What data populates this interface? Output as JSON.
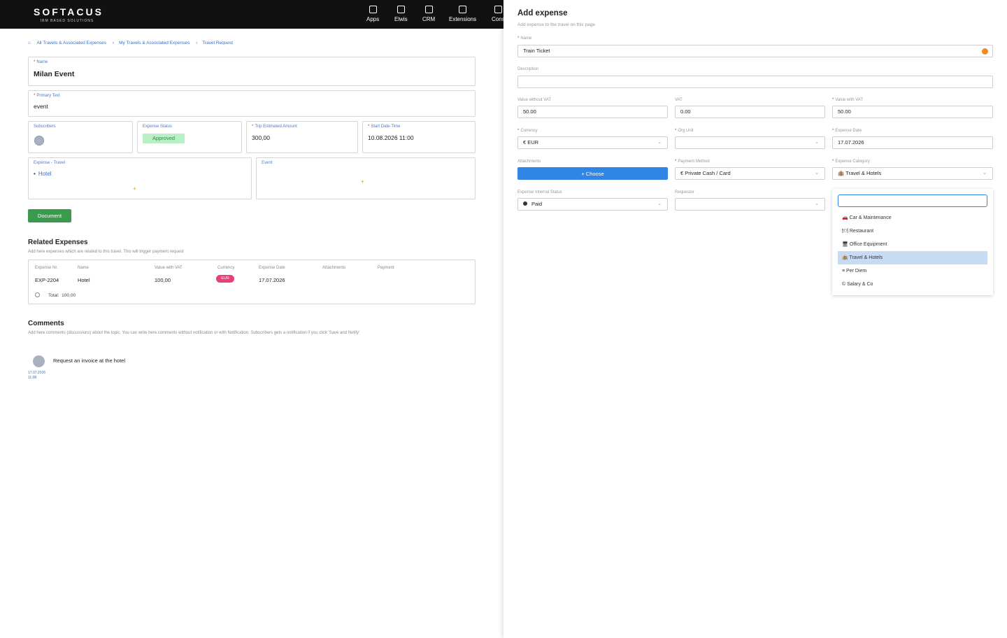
{
  "topbar": {
    "brand": "SOFTACUS",
    "tagline": "IBM BASED SOLUTIONS",
    "nav": [
      {
        "label": "Apps",
        "icon": "apps-icon"
      },
      {
        "label": "Elwis",
        "icon": "elwis-icon"
      },
      {
        "label": "CRM",
        "icon": "crm-icon"
      },
      {
        "label": "Extensions",
        "icon": "extensions-icon"
      },
      {
        "label": "Cons",
        "icon": "console-icon"
      }
    ]
  },
  "breadcrumb": {
    "home_icon": "home-icon",
    "items": [
      "All Travels & Associated Expenses",
      "My Travels & Associated Expenses",
      "Travel Request"
    ]
  },
  "travel": {
    "name_label": "Name",
    "name_value": "Milan Event",
    "primary_text_label": "Primary Text",
    "primary_text_value": "event",
    "subscribers_label": "Subscribers",
    "expense_status_label": "Expense Status",
    "expense_status_value": "Approved",
    "trip_amount_label": "Trip Estimated Amount",
    "trip_amount_value": "300,00",
    "start_label": "Start Date-Time",
    "start_value": "10.08.2026 11:00",
    "expense_travel_label": "Expense - Travel",
    "expense_travel_item": "Hotel",
    "event_label": "Event",
    "add_symbol": "+",
    "document_button": "Document"
  },
  "related": {
    "title": "Related Expenses",
    "subtitle": "Add here expenses which are related to this travel. This will trigger payment request",
    "columns": [
      "Expense Nr.",
      "Name",
      "Value with VAT",
      "Currency",
      "Expense Date",
      "Attachments",
      "Payment"
    ],
    "row": {
      "nr": "EXP-2204",
      "name": "Hotel",
      "value": "100,00",
      "currency": "EUR",
      "date": "17.07.2026"
    },
    "total_label": "Total:",
    "total_value": "100,00"
  },
  "comments": {
    "title": "Comments",
    "subtitle": "Add here comments (discussions) about the topic. You can write here comments without notification or with Notification. Subscribers gets a notification if you click 'Save and Notify'",
    "item_text": "Request an invoice at the hotel",
    "item_date": "17.07.2026",
    "item_time": "11:08"
  },
  "drawer": {
    "title": "Add expense",
    "subtitle": "Add expense  to the travel on this page",
    "name_label": "Name",
    "name_value": "Train Ticket",
    "description_label": "Description",
    "description_value": "",
    "value_wo_vat_label": "Value without VAT",
    "value_wo_vat": "50.00",
    "vat_label": "VAT",
    "vat": "0.00",
    "value_with_vat_label": "Value with VAT",
    "value_with_vat": "50.00",
    "currency_label": "Currency",
    "currency_value": "€  EUR",
    "org_unit_label": "Org Unit",
    "org_unit_value": "",
    "expense_date_label": "Expense Date",
    "expense_date_value": "17.07.2026",
    "attachments_label": "Attachments",
    "choose_button": "+ Choose",
    "payment_method_label": "Payment Method",
    "payment_method_value": "€  Private Cash / Card",
    "category_label": "Expense Category",
    "category_value": "🏨 Travel & Hotels",
    "internal_status_label": "Expense Internal Status",
    "internal_status_value": "Paid",
    "requestor_label": "Requestor",
    "requestor_value": "",
    "category_options": [
      {
        "label": "🚗 Car & Maintenance",
        "selected": false
      },
      {
        "label": "🍽 Restaurant",
        "selected": false
      },
      {
        "label": "🖥 Office Equipment",
        "selected": false
      },
      {
        "label": "🏨 Travel & Hotels",
        "selected": true
      },
      {
        "label": "≡ Per Diem",
        "selected": false
      },
      {
        "label": "© Salary & Co",
        "selected": false
      }
    ]
  },
  "colors": {
    "topbar": "#111111",
    "link": "#3b6fc4",
    "approved_bg": "#b8efc4",
    "document_button": "#3a9a4e",
    "choose_button": "#2f86e4",
    "eur_badge": "#e8407a",
    "orange_dot": "#f08a24",
    "selected_option": "#c7dcf3"
  }
}
